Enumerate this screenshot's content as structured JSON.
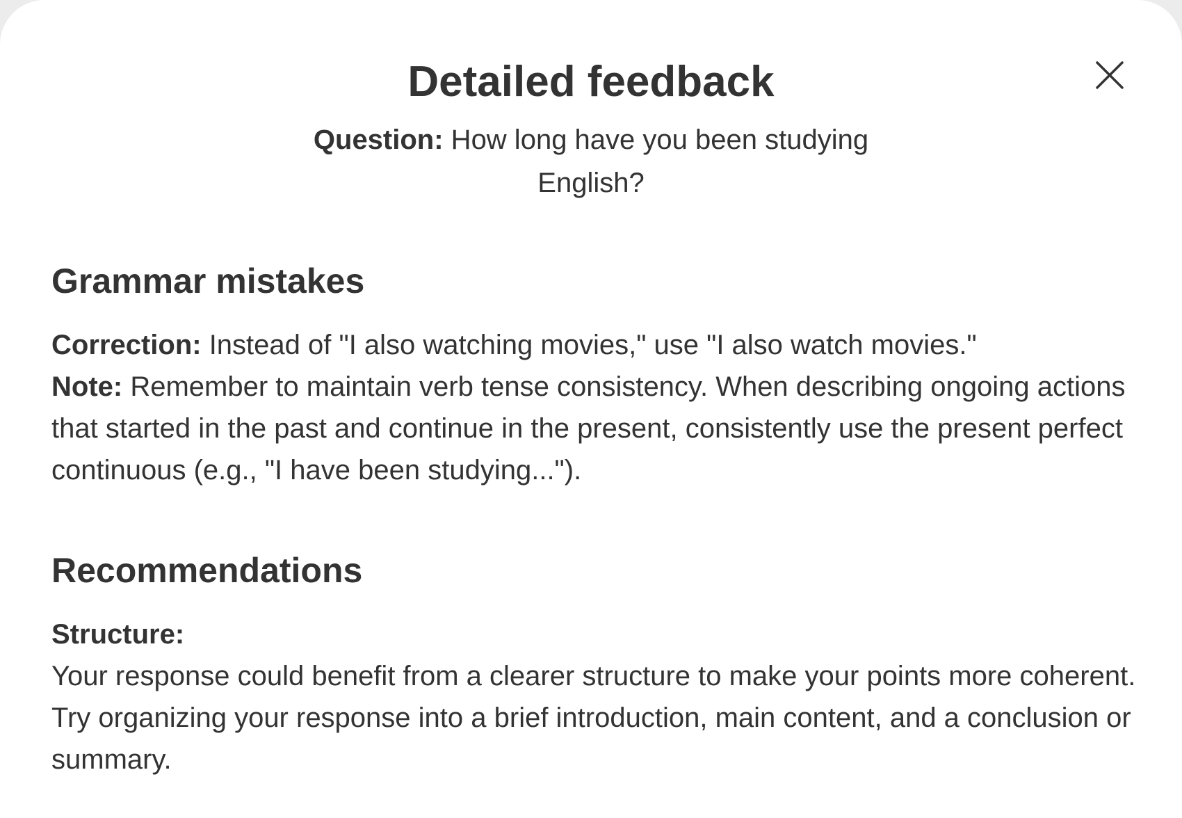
{
  "modal": {
    "title": "Detailed feedback",
    "question_label": "Question:",
    "question_text": " How long have you been studying English?",
    "close_icon": "close-icon"
  },
  "grammar": {
    "heading": "Grammar mistakes",
    "correction_label": "Correction:",
    "correction_text": " Instead of \"I also watching movies,\" use \"I also watch movies.\"",
    "note_label": "Note:",
    "note_text": " Remember to maintain verb tense consistency. When describing ongoing actions that started in the past and continue in the present, consistently use the present perfect continuous (e.g., \"I have been studying...\")."
  },
  "recommendations": {
    "heading": "Recommendations",
    "structure_label": "Structure:",
    "structure_text": "Your response could benefit from a clearer structure to make your points more coherent. Try organizing your response into a brief introduction, main content, and a conclusion or summary."
  },
  "colors": {
    "text": "#333333",
    "background": "#ffffff"
  }
}
